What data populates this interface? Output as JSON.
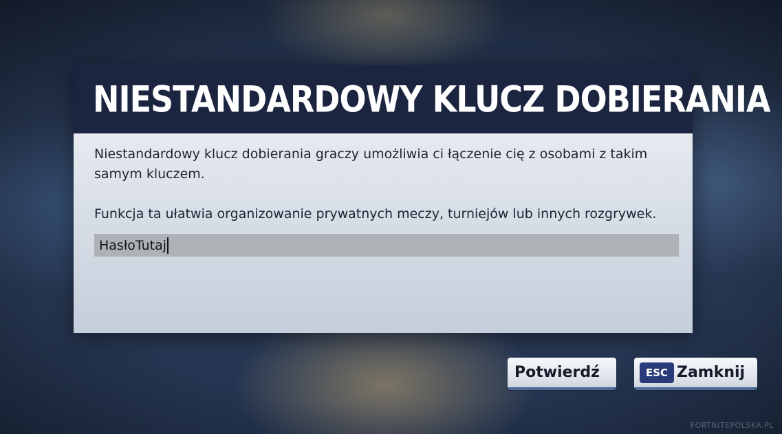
{
  "dialog": {
    "title": "NIESTANDARDOWY KLUCZ DOBIERANIA",
    "description_1": "Niestandardowy klucz dobierania graczy umożliwia ci łączenie cię z osobami z takim samym kluczem.",
    "description_2": "Funkcja ta ułatwia organizowanie prywatnych meczy, turniejów lub innych rozgrywek.",
    "key_input": {
      "value": "HasłoTutaj"
    },
    "buttons": {
      "confirm_label": "Potwierdź",
      "close_key": "ESC",
      "close_label": "Zamknij"
    }
  },
  "watermark": "FORTNITEPOLSKA.PL",
  "colors": {
    "header_bg": "#1c2540",
    "body_bg": "#dfe4ea",
    "input_bg": "#aeb2b7",
    "button_accent": "#4f6d98",
    "esc_badge": "#2b3a78"
  }
}
